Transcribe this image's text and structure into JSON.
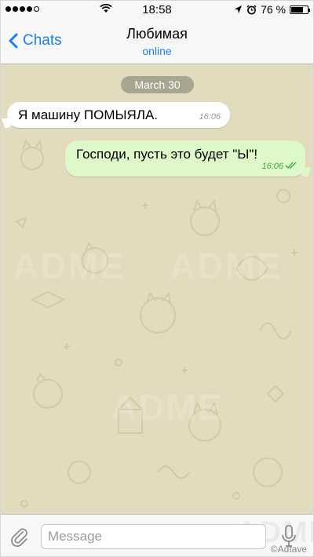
{
  "status_bar": {
    "time": "18:58",
    "battery": "76 %",
    "battery_level": 0.76,
    "signal_bars": 4
  },
  "nav": {
    "back_label": "Chats",
    "title": "Любимая",
    "status": "online"
  },
  "chat": {
    "date": "March 30",
    "messages": [
      {
        "direction": "incoming",
        "text": "Я машину ПОМЫЯЛА.",
        "time": "16:06"
      },
      {
        "direction": "outgoing",
        "text": "Господи, пусть это будет \"Ы\"!",
        "time": "16:06",
        "status": "read"
      }
    ],
    "watermark": "ADME"
  },
  "input": {
    "placeholder": "Message",
    "value": ""
  },
  "credit": "©Adfave",
  "icons": [
    "chevron-left-icon",
    "wifi-icon",
    "location-arrow-icon",
    "alarm-icon",
    "battery-icon",
    "paperclip-icon",
    "microphone-icon",
    "double-check-icon"
  ],
  "colors": {
    "accent": "#1a7ff5",
    "chat_bg": "#e3dbbd",
    "outgoing_bubble": "#dff8c9",
    "incoming_bubble": "#ffffff",
    "read_check": "#3fa84a"
  }
}
